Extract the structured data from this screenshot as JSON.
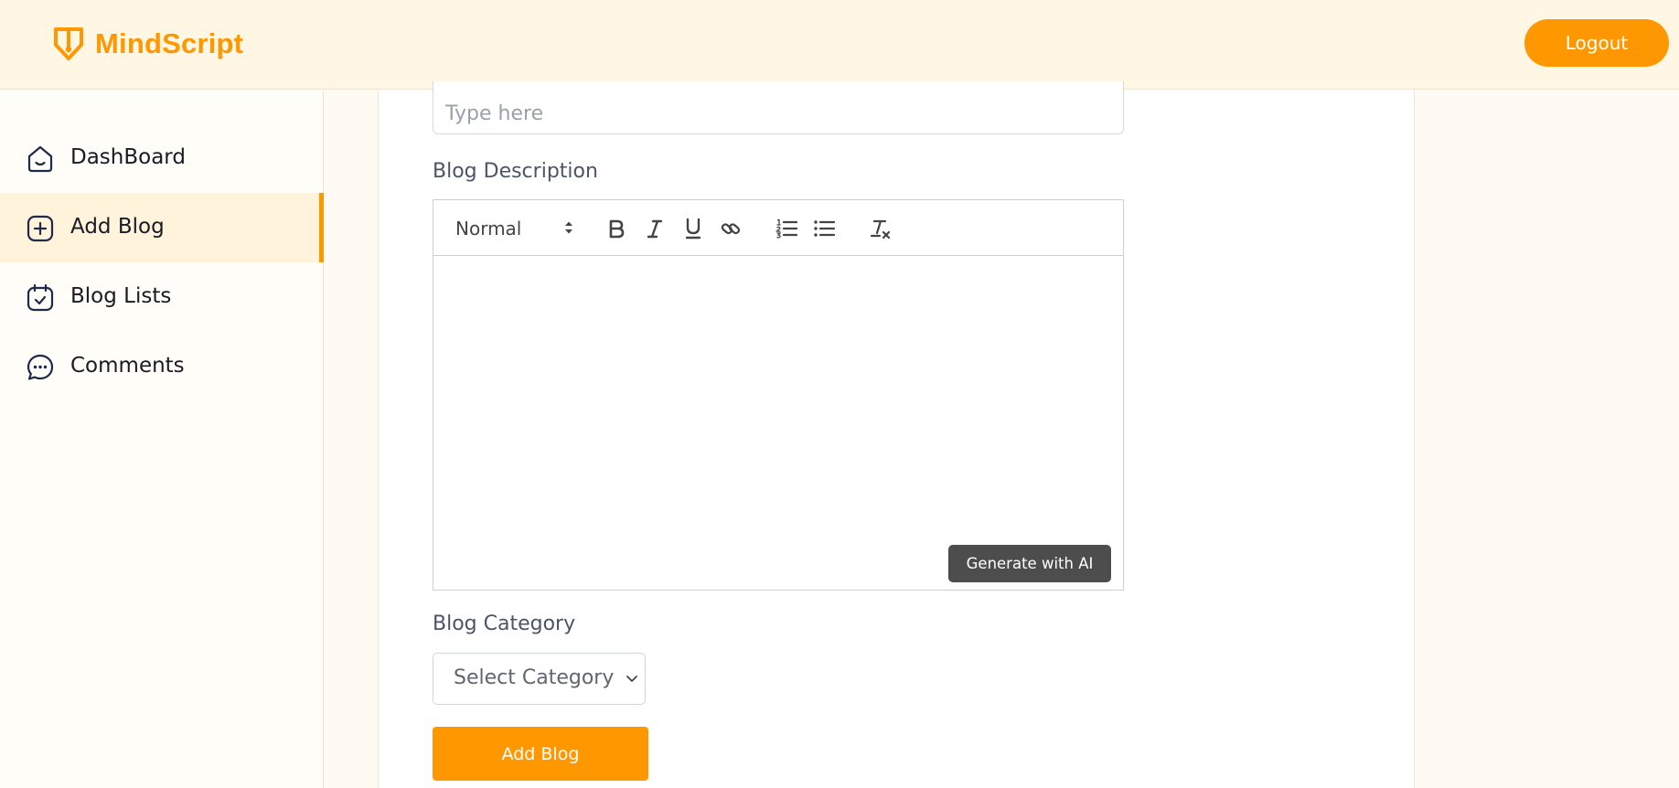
{
  "header": {
    "brand_name": "MindScript",
    "logout_label": "Logout"
  },
  "sidebar": {
    "items": [
      {
        "label": "DashBoard",
        "icon": "home-icon",
        "active": false
      },
      {
        "label": "Add Blog",
        "icon": "add-square-icon",
        "active": true
      },
      {
        "label": "Blog Lists",
        "icon": "calendar-check-icon",
        "active": false
      },
      {
        "label": "Comments",
        "icon": "chat-bubble-icon",
        "active": false
      }
    ]
  },
  "form": {
    "title_placeholder": "Type here",
    "title_value": "",
    "description_label": "Blog Description",
    "editor": {
      "size_label": "Normal",
      "tools": [
        "bold-icon",
        "italic-icon",
        "underline-icon",
        "link-icon",
        "ordered-list-icon",
        "bullet-list-icon",
        "clear-format-icon"
      ],
      "content": ""
    },
    "generate_ai_label": "Generate with AI",
    "category_label": "Blog Category",
    "category_selected": "Select Category",
    "submit_label": "Add Blog"
  },
  "colors": {
    "accent": "#ff9800",
    "header_bg": "#fff6e3",
    "active_nav_bg": "#fff3dc",
    "ai_button_bg": "#4d4d4d",
    "nav_icon": "#1e2a4a"
  }
}
